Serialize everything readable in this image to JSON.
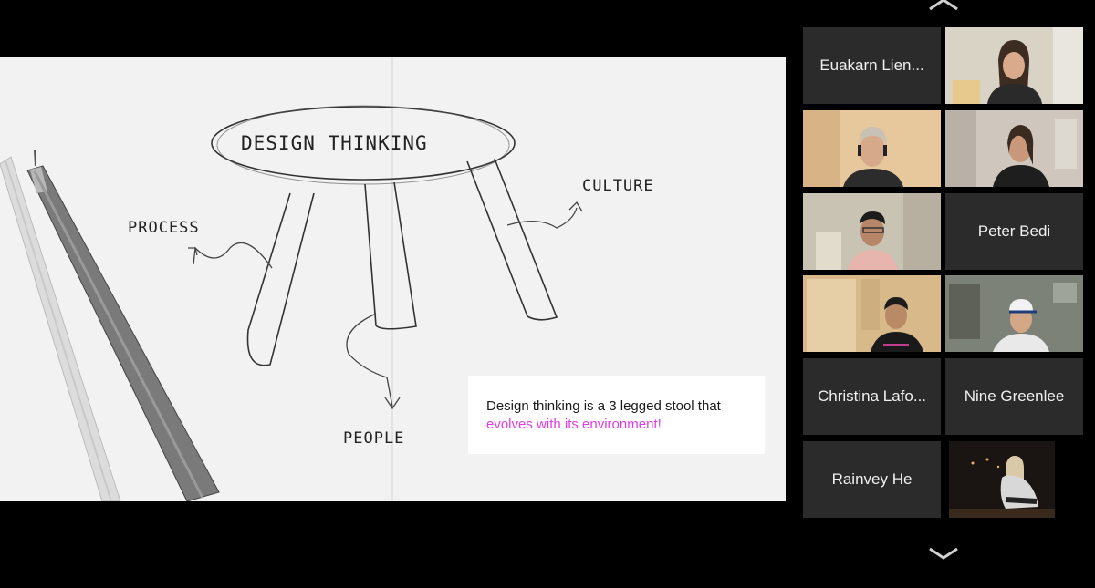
{
  "slide": {
    "title": "DESIGN THINKING",
    "labels": {
      "process": "PROCESS",
      "culture": "CULTURE",
      "people": "PEOPLE"
    },
    "caption_line1": "Design thinking is a 3 legged stool that",
    "caption_highlight": "evolves with its environment!",
    "highlight_color": "#e23ce6"
  },
  "gallery": {
    "scroll_up_icon": "chevron-up-icon",
    "scroll_down_icon": "chevron-down-icon",
    "participants": [
      {
        "name": "Euakarn Lien...",
        "video": false
      },
      {
        "video": true
      },
      {
        "video": true
      },
      {
        "video": true,
        "active_speaker": true
      },
      {
        "video": true
      },
      {
        "name": "Peter Bedi",
        "video": false
      },
      {
        "video": true
      },
      {
        "video": true
      },
      {
        "name": "Christina Lafo...",
        "video": false
      },
      {
        "name": "Nine Greenlee",
        "video": false
      },
      {
        "name": "Rainvey He",
        "video": false
      },
      {
        "video": true
      }
    ],
    "active_speaker_color": "#9be23a"
  }
}
